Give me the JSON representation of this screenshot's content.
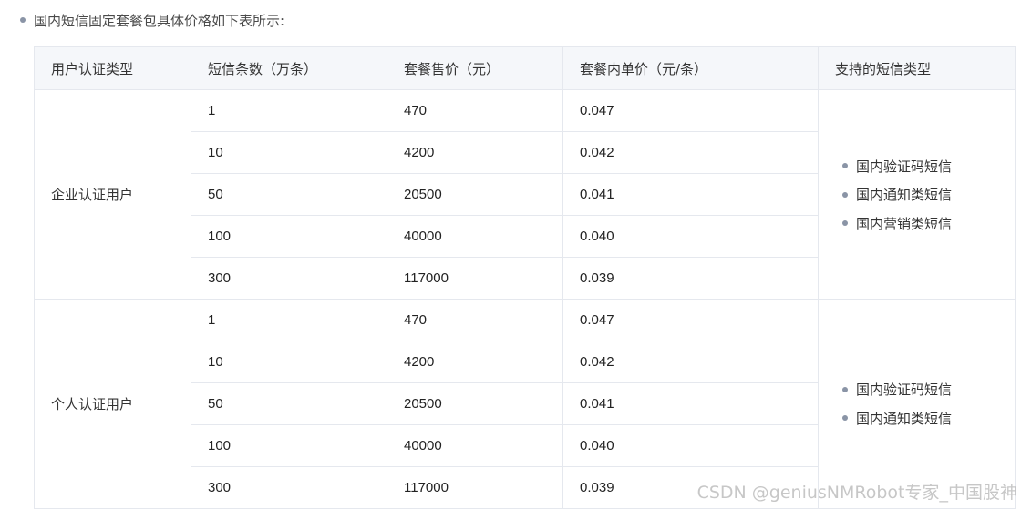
{
  "intro_text": "国内短信固定套餐包具体价格如下表所示:",
  "table": {
    "headers": [
      "用户认证类型",
      "短信条数（万条）",
      "套餐售价（元）",
      "套餐内单价（元/条）",
      "支持的短信类型"
    ],
    "groups": [
      {
        "user_type": "企业认证用户",
        "rows": [
          [
            "1",
            "470",
            "0.047"
          ],
          [
            "10",
            "4200",
            "0.042"
          ],
          [
            "50",
            "20500",
            "0.041"
          ],
          [
            "100",
            "40000",
            "0.040"
          ],
          [
            "300",
            "117000",
            "0.039"
          ]
        ],
        "sms_types": [
          "国内验证码短信",
          "国内通知类短信",
          "国内营销类短信"
        ]
      },
      {
        "user_type": "个人认证用户",
        "rows": [
          [
            "1",
            "470",
            "0.047"
          ],
          [
            "10",
            "4200",
            "0.042"
          ],
          [
            "50",
            "20500",
            "0.041"
          ],
          [
            "100",
            "40000",
            "0.040"
          ],
          [
            "300",
            "117000",
            "0.039"
          ]
        ],
        "sms_types": [
          "国内验证码短信",
          "国内通知类短信"
        ]
      }
    ]
  },
  "watermark": "CSDN @geniusNMRobot专家_中国股神"
}
